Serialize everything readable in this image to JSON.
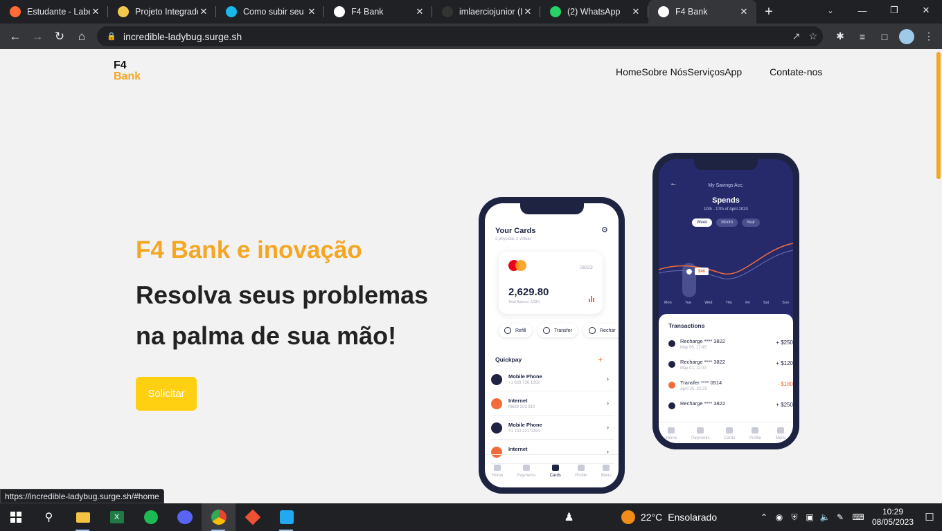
{
  "browser": {
    "tabs": [
      {
        "title": "Estudante - Labenu",
        "icon": "labenu-icon",
        "color": "#ff6b35",
        "active": false
      },
      {
        "title": "Projeto Integrado",
        "icon": "project-icon",
        "color": "#f2c94c",
        "active": false
      },
      {
        "title": "Como subir seu site",
        "icon": "vimeo-icon",
        "color": "#1ab7ea",
        "active": false
      },
      {
        "title": "F4 Bank",
        "icon": "f4-icon",
        "color": "#ffffff",
        "active": false
      },
      {
        "title": "imlaerciojunior (L",
        "icon": "github-icon",
        "color": "#333333",
        "active": false
      },
      {
        "title": "(2) WhatsApp",
        "icon": "whatsapp-icon",
        "color": "#25d366",
        "active": false
      },
      {
        "title": "F4 Bank",
        "icon": "f4-icon",
        "color": "#ffffff",
        "active": true
      }
    ],
    "url": "incredible-ladybug.surge.sh",
    "status_url": "https://incredible-ladybug.surge.sh/#home"
  },
  "site": {
    "logo_line1": "F4",
    "logo_line2": "Bank",
    "nav": [
      "Home",
      "Sobre Nós",
      "Serviços",
      "App"
    ],
    "contact": "Contate-nos",
    "hero_subtitle": "F4 Bank e inovação",
    "hero_title": "Resolva seus problemas na palma de sua mão!",
    "cta": "Solicitar",
    "colors": {
      "accent": "#f5a623",
      "button": "#ffd011",
      "phone": "#1d2340"
    }
  },
  "phone_left": {
    "title": "Your Cards",
    "subtitle": "2 physical, 1 virtual",
    "card_expiry": "08/23",
    "card_balance": "2,629.80",
    "card_balance_label": "Total Balance (USD)",
    "actions": [
      "Refill",
      "Transfer",
      "Rechar"
    ],
    "quickpay_title": "Quickpay",
    "quickpay": [
      {
        "name": "Mobile Phone",
        "sub": "+1 629 736 1002",
        "color": "#1d2340"
      },
      {
        "name": "Internet",
        "sub": "M689 203 910",
        "color": "#f26b3a"
      },
      {
        "name": "Mobile Phone",
        "sub": "+1 102 221 0294",
        "color": "#1d2340"
      },
      {
        "name": "Internet",
        "sub": "",
        "color": "#f26b3a"
      }
    ],
    "nav": [
      "Home",
      "Payments",
      "Cards",
      "Profile",
      "Menu"
    ],
    "nav_active": "Cards"
  },
  "phone_right": {
    "header": "My Savings Acc.",
    "title": "Spends",
    "range": "10th - 17th of April 2020",
    "filters": [
      "Week",
      "Month",
      "Year"
    ],
    "marker": "$40",
    "days": [
      "Mon",
      "Tue",
      "Wed",
      "Thu",
      "Fri",
      "Sat",
      "Sun"
    ],
    "transactions_title": "Transactions",
    "transactions": [
      {
        "name": "Recharge **** 3822",
        "date": "May 05, 17:45",
        "amount": "+ $250",
        "color": "#1d2340"
      },
      {
        "name": "Recharge **** 3822",
        "date": "May 01, 11:00",
        "amount": "+ $120",
        "color": "#1d2340"
      },
      {
        "name": "Transfer **** 0514",
        "date": "April 25, 22:23",
        "amount": "- $180",
        "color": "#f26b3a"
      },
      {
        "name": "Recharge **** 3822",
        "date": "",
        "amount": "+ $250",
        "color": "#1d2340"
      }
    ],
    "nav": [
      "Home",
      "Payments",
      "Cards",
      "Profile",
      "Menu"
    ]
  },
  "taskbar": {
    "weather_temp": "22°C",
    "weather_text": "Ensolarado",
    "time": "10:29",
    "date": "08/05/2023"
  }
}
